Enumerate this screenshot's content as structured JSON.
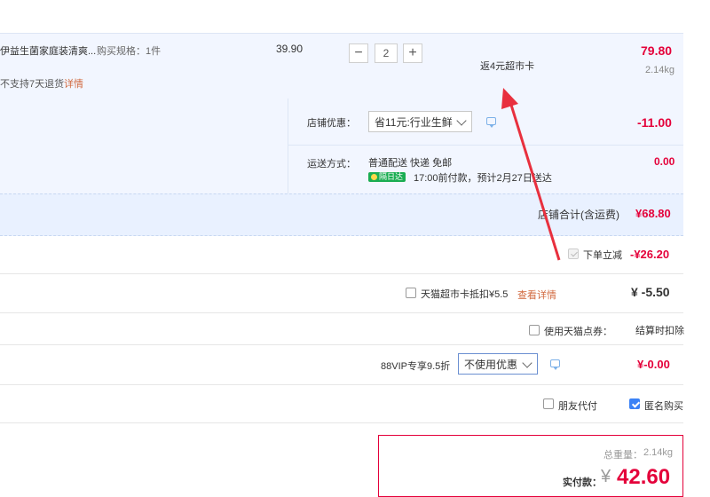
{
  "product": {
    "name": "伊益生菌家庭装清爽...",
    "spec": "购买规格：1件",
    "no_return": "不支持7天退货",
    "details_link": "详情",
    "unit_price": "39.90",
    "quantity": "2",
    "rebate": "返4元超市卡",
    "total_price": "79.80",
    "weight": "2.14kg"
  },
  "shop_discount": {
    "label": "店铺优惠：",
    "selected": "省11元:行业生鲜",
    "amount": "-11.00"
  },
  "shipping": {
    "label": "运送方式：",
    "method": "普通配送 快递 免邮",
    "badge": "隔日达",
    "eta": "17:00前付款，预计2月27日送达",
    "amount": "0.00"
  },
  "shop_total": {
    "label": "店铺合计(含运费)",
    "amount": "¥68.80"
  },
  "instant_discount": {
    "label": "下单立减",
    "amount": "-¥26.20",
    "checked": true
  },
  "supermarket_card": {
    "label": "天猫超市卡抵扣¥5.5",
    "link": "查看详情",
    "amount": "¥ -5.50"
  },
  "tmall_points": {
    "label": "使用天猫点券：",
    "note": "结算时扣除"
  },
  "vip": {
    "label": "88VIP专享9.5折",
    "selected": "不使用优惠",
    "amount": "¥-0.00"
  },
  "options": {
    "friend_pay": "朋友代付",
    "anonymous": "匿名购买",
    "anonymous_checked": true
  },
  "summary": {
    "total_weight_label": "总重量：",
    "total_weight": "2.14kg",
    "paid_label": "实付款：",
    "currency": "¥",
    "paid_amount": "42.60"
  },
  "colors": {
    "price_red": "#e4003a",
    "arrow_red": "#e8303e",
    "link_orange": "#d1693f",
    "panel_blue": "#f2f6ff"
  }
}
